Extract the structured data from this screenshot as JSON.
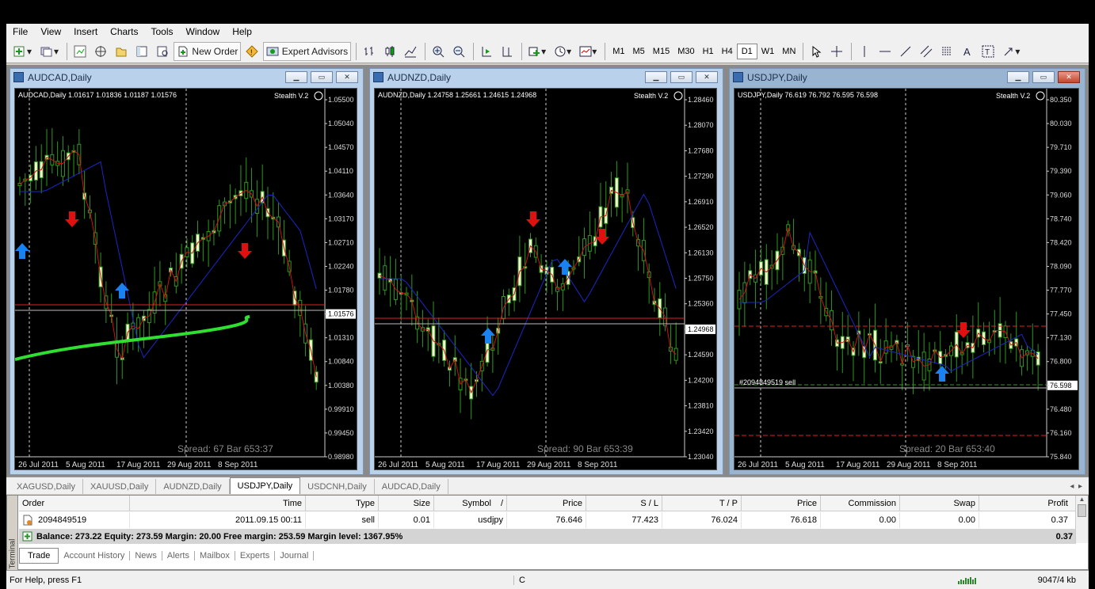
{
  "menu": [
    "File",
    "View",
    "Insert",
    "Charts",
    "Tools",
    "Window",
    "Help"
  ],
  "toolbar": {
    "new_order": "New Order",
    "expert_advisors": "Expert Advisors",
    "timeframes": [
      "M1",
      "M5",
      "M15",
      "M30",
      "H1",
      "H4",
      "D1",
      "W1",
      "MN"
    ],
    "active_timeframe": "D1",
    "icons": [
      "new-chart-icon",
      "profiles-icon",
      "market-watch-icon",
      "navigator-icon",
      "data-window-icon",
      "terminal-icon",
      "strategy-tester-icon",
      "new-order-icon",
      "meta-editor-icon",
      "expert-advisors-icon",
      "bar-chart-icon",
      "candlesticks-icon",
      "line-chart-icon",
      "zoom-in-icon",
      "zoom-out-icon",
      "auto-scroll-icon",
      "chart-shift-icon",
      "indicators-icon",
      "periods-icon",
      "templates-icon",
      "cursor-icon",
      "crosshair-icon",
      "vertical-line-icon",
      "horizontal-line-icon",
      "trendline-icon",
      "equidistant-channel-icon",
      "fibonacci-icon",
      "text-icon",
      "text-label-icon",
      "arrows-icon"
    ]
  },
  "charts": [
    {
      "title": "AUDCAD,Daily",
      "info": "AUDCAD,Daily  1.01617 1.01836 1.01187 1.01576",
      "indicator": "Stealth V.2",
      "spread": "Spread: 67  Bar  653:37",
      "ticks": [
        "1.05500",
        "1.05040",
        "1.04570",
        "1.04110",
        "1.03640",
        "1.03170",
        "1.02710",
        "1.02240",
        "1.01780",
        "1.01576",
        "1.01310",
        "1.00840",
        "1.00380",
        "0.99910",
        "0.99450",
        "0.98980"
      ],
      "dates": [
        "26 Jul 2011",
        "5 Aug 2011",
        "17 Aug 2011",
        "29 Aug 2011",
        "8 Sep 2011"
      ],
      "price": "1.01576",
      "bid_line": "1.01780",
      "active": false
    },
    {
      "title": "AUDNZD,Daily",
      "info": "AUDNZD,Daily  1.24758 1.25661 1.24615 1.24968",
      "indicator": "Stealth V.2",
      "spread": "Spread: 90  Bar  653:39",
      "ticks": [
        "1.28460",
        "1.28070",
        "1.27680",
        "1.27290",
        "1.26910",
        "1.26520",
        "1.26130",
        "1.25750",
        "1.25360",
        "1.24968",
        "1.24590",
        "1.24200",
        "1.23810",
        "1.23420",
        "1.23040"
      ],
      "dates": [
        "26 Jul 2011",
        "5 Aug 2011",
        "17 Aug 2011",
        "29 Aug 2011",
        "8 Sep 2011"
      ],
      "price": "1.24968",
      "bid_line": "1.25035",
      "active": false
    },
    {
      "title": "USDJPY,Daily",
      "info": "USDJPY,Daily  76.619 76.792 76.595 76.598",
      "indicator": "Stealth V.2",
      "spread": "Spread: 20  Bar  653:40",
      "ticks": [
        "80.350",
        "80.030",
        "79.710",
        "79.390",
        "79.060",
        "78.740",
        "78.420",
        "78.090",
        "77.770",
        "77.450",
        "77.130",
        "76.800",
        "76.598",
        "76.480",
        "76.160",
        "75.840"
      ],
      "dates": [
        "26 Jul 2011",
        "5 Aug 2011",
        "17 Aug 2011",
        "29 Aug 2011",
        "8 Sep 2011"
      ],
      "price": "76.598",
      "order_label": "#2094849519 sell",
      "active": true
    }
  ],
  "chart_tabs": [
    "XAGUSD,Daily",
    "XAUUSD,Daily",
    "AUDNZD,Daily",
    "USDJPY,Daily",
    "USDCNH,Daily",
    "AUDCAD,Daily"
  ],
  "active_chart_tab": "USDJPY,Daily",
  "terminal": {
    "side_label": "Terminal",
    "columns": [
      "Order",
      "Time",
      "Type",
      "Size",
      "Symbol",
      "/",
      "Price",
      "S / L",
      "T / P",
      "Price",
      "Commission",
      "Swap",
      "Profit"
    ],
    "rows": [
      [
        "2094849519",
        "2011.09.15 00:11",
        "sell",
        "0.01",
        "usdjpy",
        "",
        "76.646",
        "77.423",
        "76.024",
        "76.618",
        "0.00",
        "0.00",
        "0.37"
      ]
    ],
    "balance_line": "Balance: 273.22  Equity: 273.59  Margin: 20.00  Free margin: 253.59  Margin level: 1367.95%",
    "total_profit": "0.37",
    "tabs": [
      "Trade",
      "Account History",
      "News",
      "Alerts",
      "Mailbox",
      "Experts",
      "Journal"
    ],
    "active_tab": "Trade"
  },
  "status": {
    "help": "For Help, press F1",
    "profile": "C",
    "traffic": "9047/4 kb"
  }
}
